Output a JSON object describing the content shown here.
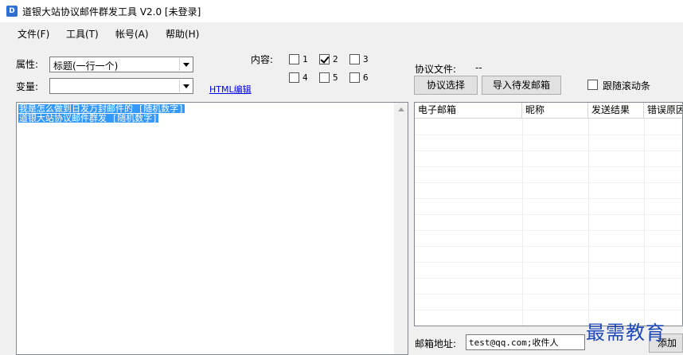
{
  "window": {
    "title": "道银大站协议邮件群发工具 V2.0 [未登录]"
  },
  "menu": [
    "文件(F)",
    "工具(T)",
    "帐号(A)",
    "帮助(H)"
  ],
  "form": {
    "attr_label": "属性:",
    "attr_value": "标题(一行一个)",
    "var_label": "变量:",
    "var_value": "",
    "html_link": "HTML编辑",
    "content_label": "内容:",
    "content_options": [
      {
        "label": "1",
        "checked": false
      },
      {
        "label": "2",
        "checked": true
      },
      {
        "label": "3",
        "checked": false
      },
      {
        "label": "4",
        "checked": false
      },
      {
        "label": "5",
        "checked": false
      },
      {
        "label": "6",
        "checked": false
      }
    ]
  },
  "editor": {
    "lines": [
      "我是怎么做到日发万封邮件的 [随机数字]",
      "道银大站协议邮件群发 [随机数字]"
    ]
  },
  "protocol": {
    "file_label": "协议文件:",
    "file_value": "--",
    "select_button": "协议选择",
    "import_button": "导入待发邮箱",
    "follow_scroll_label": "跟随滚动条",
    "follow_scroll_checked": false
  },
  "table": {
    "columns": [
      "电子邮箱",
      "昵称",
      "发送结果",
      "错误原因"
    ],
    "rows": []
  },
  "footer": {
    "mail_label": "邮箱地址:",
    "mail_value": "test@qq.com;收件人",
    "add_button": "添加"
  },
  "watermark": "最需教育"
}
